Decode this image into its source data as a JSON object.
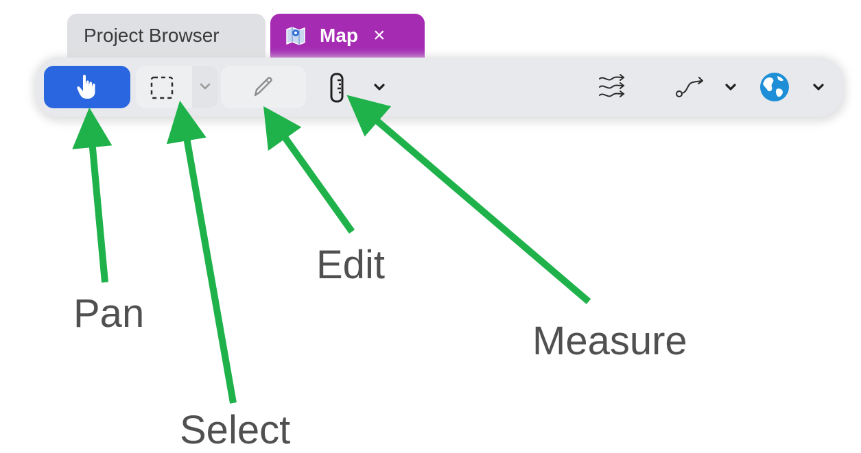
{
  "tabs": [
    {
      "label": "Project Browser",
      "active": false
    },
    {
      "label": "Map",
      "active": true,
      "icon": "map-icon",
      "close": "×"
    }
  ],
  "toolbar": {
    "tools": [
      {
        "name": "pan",
        "icon": "hand-pointer-icon",
        "selected": true
      },
      {
        "name": "select",
        "icon": "dashed-rectangle-icon",
        "has_dropdown": true
      },
      {
        "name": "edit",
        "icon": "pencil-icon"
      },
      {
        "name": "measure",
        "icon": "ruler-icon",
        "has_dropdown": true
      },
      {
        "name": "flow",
        "icon": "wind-arrows-icon"
      },
      {
        "name": "route",
        "icon": "path-arrow-icon",
        "has_dropdown": true
      },
      {
        "name": "basemap",
        "icon": "globe-icon",
        "has_dropdown": true
      }
    ]
  },
  "annotations": {
    "pan": "Pan",
    "select": "Select",
    "edit": "Edit",
    "measure": "Measure"
  },
  "colors": {
    "map_tab": "#a52bb3",
    "pan_active": "#2966e0",
    "arrow": "#1fb24a",
    "globe": "#1e8fd6"
  }
}
